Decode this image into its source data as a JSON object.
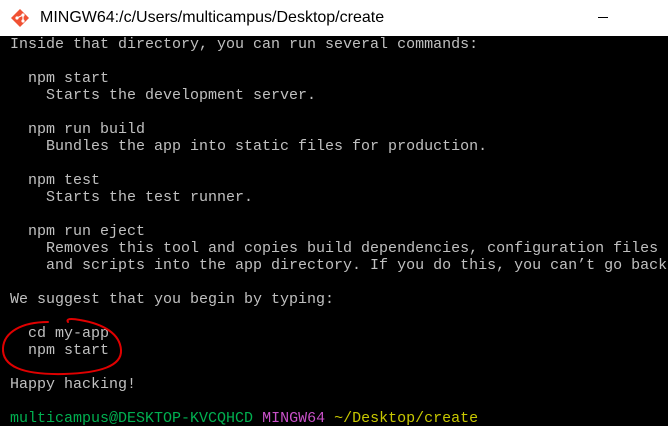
{
  "window": {
    "title": "MINGW64:/c/Users/multicampus/Desktop/create",
    "app_icon": "git-bash-icon",
    "minimize_icon": "minimize-icon"
  },
  "terminal": {
    "lines": [
      "Inside that directory, you can run several commands:",
      "  npm start",
      "    Starts the development server.",
      "  npm run build",
      "    Bundles the app into static files for production.",
      "  npm test",
      "    Starts the test runner.",
      "  npm run eject",
      "    Removes this tool and copies build dependencies, configuration files",
      "    and scripts into the app directory. If you do this, you can’t go back",
      "We suggest that you begin by typing:",
      "  cd my-app",
      "  npm start",
      "Happy hacking!"
    ],
    "prompt": {
      "user_host": "multicampus@DESKTOP-KVCQHCD",
      "shell": "MINGW64",
      "path": "~/Desktop/create"
    }
  },
  "colors": {
    "background": "#000000",
    "text": "#c0c0c0",
    "prompt_user": "#00b050",
    "prompt_shell": "#c850c8",
    "prompt_path": "#c8c800",
    "annotation": "#e00000"
  }
}
